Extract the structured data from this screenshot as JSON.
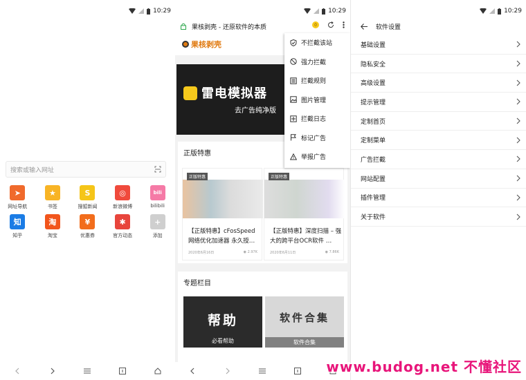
{
  "status": {
    "time": "10:29"
  },
  "home": {
    "search_placeholder": "搜索或输入网址",
    "tiles": [
      {
        "label": "网址导航",
        "icon": "navigation-arrow-icon",
        "color": "#f06a2c",
        "glyph": "➤"
      },
      {
        "label": "书签",
        "icon": "star-icon",
        "color": "#f8b425",
        "glyph": "★"
      },
      {
        "label": "搜狐新闻",
        "icon": "sohu-icon",
        "color": "#f5c518",
        "glyph": "S"
      },
      {
        "label": "新浪微博",
        "icon": "weibo-icon",
        "color": "#f04a3c",
        "glyph": "◎"
      },
      {
        "label": "bilibili",
        "icon": "bilibili-icon",
        "color": "#f57aa6",
        "glyph": "bili"
      },
      {
        "label": "知乎",
        "icon": "zhihu-icon",
        "color": "#1b7ce5",
        "glyph": "知"
      },
      {
        "label": "淘宝",
        "icon": "taobao-icon",
        "color": "#f2551c",
        "glyph": "淘"
      },
      {
        "label": "优惠券",
        "icon": "coupon-icon",
        "color": "#f26d1c",
        "glyph": "¥"
      },
      {
        "label": "官方动态",
        "icon": "pinwheel-icon",
        "color": "#e8453c",
        "glyph": "✱"
      },
      {
        "label": "添加",
        "icon": "add-icon",
        "color": "#cfcfcf",
        "glyph": "+"
      }
    ]
  },
  "browser": {
    "page_title": "果核剥壳 - 还原软件的本质",
    "coin_count": "0",
    "site_logo": "果核剥壳",
    "banner_title": "雷电模拟器",
    "banner_sub": "去广告纯净版",
    "section1_title": "正版特惠",
    "cards": [
      {
        "badge": "正版特惠",
        "title": "【正版特惠】cFosSpeed 网络优化加速器 永久授…",
        "date": "2020年6月16日",
        "views": "◉ 2.97K"
      },
      {
        "badge": "正版特惠",
        "title": "【正版特惠】深度扫描 – 强大的跨平台OCR软件 …",
        "date": "2020年6月11日",
        "views": "◉ 7.86K"
      }
    ],
    "section2_title": "专题栏目",
    "topics": [
      {
        "text": "帮助",
        "caption": "必看帮助"
      },
      {
        "text": "软件合集",
        "caption": "软件合集"
      }
    ],
    "menu": [
      {
        "label": "不拦截该站",
        "icon": "shield-check-icon"
      },
      {
        "label": "强力拦截",
        "icon": "block-circle-icon"
      },
      {
        "label": "拦截规则",
        "icon": "rules-list-icon"
      },
      {
        "label": "图片管理",
        "icon": "image-icon"
      },
      {
        "label": "拦截日志",
        "icon": "log-icon"
      },
      {
        "label": "标记广告",
        "icon": "flag-icon"
      },
      {
        "label": "举报广告",
        "icon": "warning-icon"
      }
    ],
    "watermark": "www.budog.net 不懂社区"
  },
  "settings": {
    "title": "软件设置",
    "items": [
      "基础设置",
      "隐私安全",
      "高级设置",
      "提示管理",
      "定制首页",
      "定制菜单",
      "广告拦截",
      "网站配置",
      "插件管理",
      "关于软件"
    ]
  }
}
